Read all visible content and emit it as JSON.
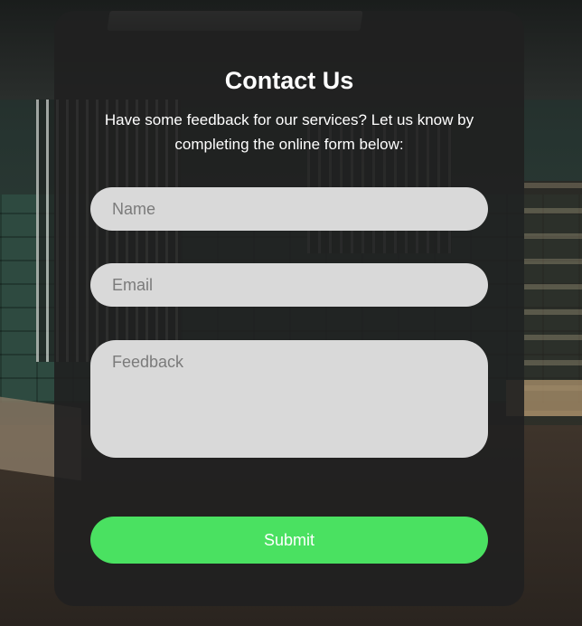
{
  "form": {
    "title": "Contact Us",
    "subtitle": "Have some feedback for our services? Let us know by completing the online form below:",
    "name_placeholder": "Name",
    "email_placeholder": "Email",
    "feedback_placeholder": "Feedback",
    "submit_label": "Submit"
  },
  "colors": {
    "card_background": "#202020",
    "input_background": "#d9d9d9",
    "submit_background": "#4ae161",
    "text": "#ffffff"
  }
}
